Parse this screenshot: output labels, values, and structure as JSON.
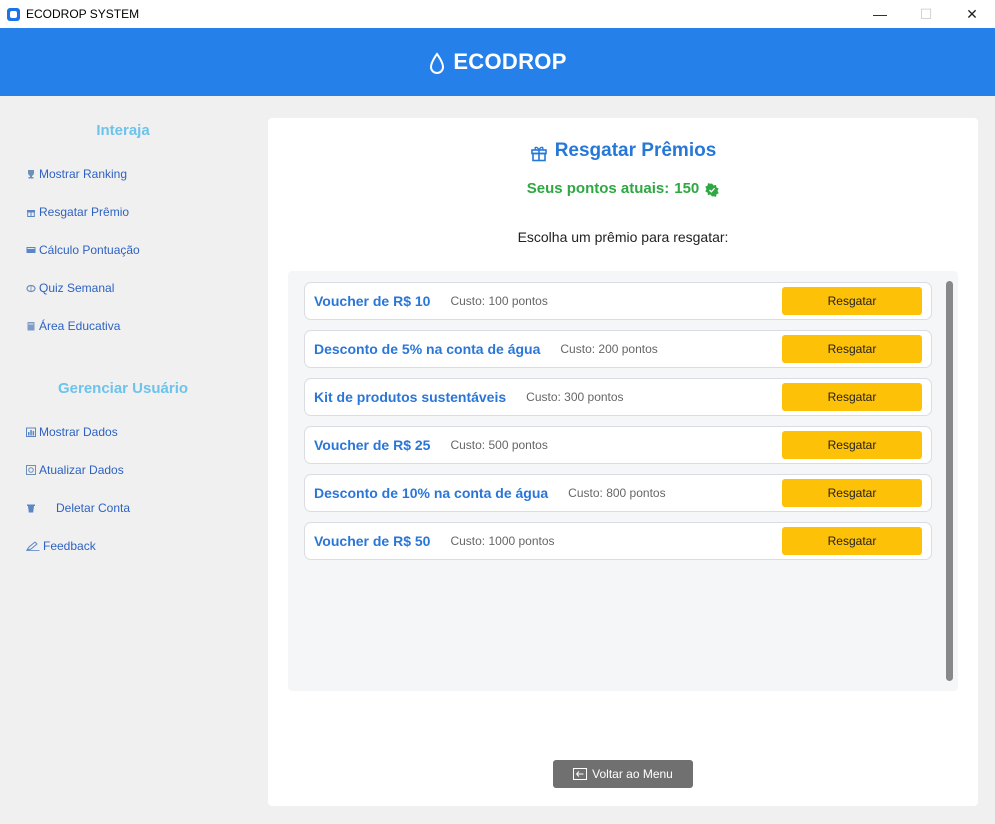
{
  "window": {
    "title": "ECODROP SYSTEM",
    "controls": {
      "minimize": "—",
      "maximize": "☐",
      "close": "✕"
    }
  },
  "header": {
    "title": "ECODROP",
    "icon": "water-drop-icon"
  },
  "sidebar": {
    "section1_title": "Interaja",
    "section1_items": [
      {
        "label": "Mostrar Ranking",
        "icon": "trophy-icon"
      },
      {
        "label": "Resgatar Prêmio",
        "icon": "gift-icon"
      },
      {
        "label": "Cálculo Pontuação",
        "icon": "calculator-icon"
      },
      {
        "label": "Quiz Semanal",
        "icon": "brain-icon"
      },
      {
        "label": "Área Educativa",
        "icon": "book-icon"
      }
    ],
    "section2_title": "Gerenciar Usuário",
    "section2_items": [
      {
        "label": "Mostrar Dados",
        "icon": "bar-chart-icon"
      },
      {
        "label": "Atualizar Dados",
        "icon": "refresh-icon"
      },
      {
        "label": "Deletar Conta",
        "icon": "trash-icon"
      },
      {
        "label": "Feedback",
        "icon": "pencil-icon"
      }
    ]
  },
  "main": {
    "title": "Resgatar Prêmios",
    "points_label": "Seus pontos atuais:",
    "points_value": "150",
    "subtitle": "Escolha um prêmio para resgatar:",
    "prizes": [
      {
        "name": "Voucher de R$ 10",
        "cost": "Custo: 100 pontos",
        "button": "Resgatar"
      },
      {
        "name": "Desconto de 5% na conta de água",
        "cost": "Custo: 200 pontos",
        "button": "Resgatar"
      },
      {
        "name": "Kit de produtos sustentáveis",
        "cost": "Custo: 300 pontos",
        "button": "Resgatar"
      },
      {
        "name": "Voucher de R$ 25",
        "cost": "Custo: 500 pontos",
        "button": "Resgatar"
      },
      {
        "name": "Desconto de 10% na conta de água",
        "cost": "Custo: 800 pontos",
        "button": "Resgatar"
      },
      {
        "name": "Voucher de R$ 50",
        "cost": "Custo: 1000 pontos",
        "button": "Resgatar"
      }
    ],
    "back_button": "Voltar ao Menu"
  },
  "colors": {
    "header": "#2680ea",
    "accent_blue": "#2678d8",
    "points_green": "#2fa743",
    "button_yellow": "#fdc107",
    "sidebar_heading": "#6cc3ec",
    "back_button": "#707070"
  }
}
